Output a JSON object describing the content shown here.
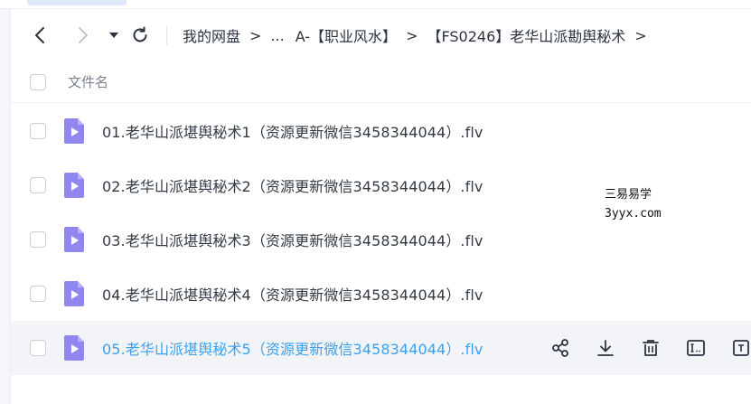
{
  "toolbar": {
    "back_icon": "chevron-left-icon",
    "forward_icon": "chevron-right-icon",
    "dropdown_icon": "caret-down-icon",
    "refresh_icon": "refresh-icon"
  },
  "breadcrumb": {
    "items": [
      "我的网盘",
      "...",
      "A-【职业风水】",
      "【FS0246】老华山派勘舆秘术"
    ],
    "separator": ">"
  },
  "table": {
    "header": "文件名",
    "files": [
      {
        "name": "01.老华山派堪舆秘术1（资源更新微信3458344044）.flv",
        "icon": "video-file-icon"
      },
      {
        "name": "02.老华山派堪舆秘术2（资源更新微信3458344044）.flv",
        "icon": "video-file-icon"
      },
      {
        "name": "03.老华山派堪舆秘术3（资源更新微信3458344044）.flv",
        "icon": "video-file-icon"
      },
      {
        "name": "04.老华山派堪舆秘术4（资源更新微信3458344044）.flv",
        "icon": "video-file-icon"
      },
      {
        "name": "05.老华山派堪舆秘术5（资源更新微信3458344044）.flv",
        "icon": "video-file-icon"
      }
    ],
    "row_actions": [
      "share-icon",
      "download-icon",
      "delete-icon",
      "rename-icon",
      "more-icon"
    ]
  },
  "watermark": {
    "line1": "三易易学",
    "line2": "3yyx.com"
  },
  "colors": {
    "accent": "#3aa0f0",
    "file_icon": "#8f86f0",
    "hover_row": "#f3f4f7"
  }
}
